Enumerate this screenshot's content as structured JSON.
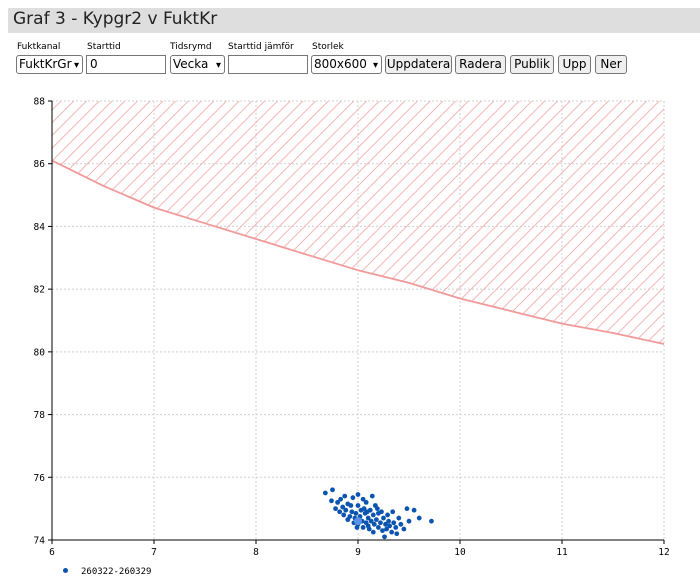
{
  "window": {
    "title": "Graf 3 - Kypgr2 v FuktKr"
  },
  "controls": {
    "fuktkanal": {
      "label": "Fuktkanal",
      "value": "FuktKrGr"
    },
    "starttid": {
      "label": "Starttid",
      "value": "0"
    },
    "tidsrymd": {
      "label": "Tidsrymd",
      "value": "Vecka"
    },
    "starttid_jamfor": {
      "label": "Starttid jämför",
      "value": ""
    },
    "storlek": {
      "label": "Storlek",
      "value": "800x600"
    },
    "buttons": {
      "uppdatera": "Uppdatera",
      "radera": "Radera",
      "publik": "Publik",
      "upp": "Upp",
      "ner": "Ner"
    }
  },
  "colors": {
    "limit_line": "#f09a9a",
    "hatch": "#f5b5b5",
    "points": "#0b55b0",
    "centroid": "#5b8fe8",
    "grid": "#d0d0d0"
  },
  "chart_data": {
    "type": "scatter",
    "xlim": [
      6,
      12
    ],
    "ylim": [
      74,
      88
    ],
    "x_ticks": [
      "6",
      "7",
      "8",
      "9",
      "10",
      "11",
      "12"
    ],
    "y_ticks": [
      "74",
      "76",
      "78",
      "80",
      "82",
      "84",
      "86",
      "88"
    ],
    "grid": true,
    "legend": {
      "placement": "bottom-left",
      "entries": [
        "260322-260329"
      ]
    },
    "limit_curve": {
      "x": [
        6,
        6.5,
        7,
        7.5,
        8,
        8.5,
        9,
        9.5,
        10,
        10.5,
        11,
        11.5,
        12
      ],
      "y": [
        86.1,
        85.3,
        84.6,
        84.1,
        83.6,
        83.1,
        82.6,
        82.2,
        81.7,
        81.3,
        80.9,
        80.6,
        80.25
      ]
    },
    "series": [
      {
        "name": "260322-260329",
        "centroid": [
          9.0,
          74.6
        ],
        "points": [
          [
            8.68,
            75.5
          ],
          [
            8.75,
            75.6
          ],
          [
            8.74,
            75.25
          ],
          [
            8.8,
            75.2
          ],
          [
            8.78,
            75.0
          ],
          [
            8.82,
            74.9
          ],
          [
            8.85,
            75.05
          ],
          [
            8.86,
            74.8
          ],
          [
            8.88,
            74.95
          ],
          [
            8.9,
            74.65
          ],
          [
            8.9,
            75.15
          ],
          [
            8.92,
            74.75
          ],
          [
            8.94,
            74.9
          ],
          [
            8.95,
            75.35
          ],
          [
            8.96,
            74.55
          ],
          [
            8.97,
            74.7
          ],
          [
            8.98,
            74.85
          ],
          [
            9.0,
            75.45
          ],
          [
            9.0,
            75.1
          ],
          [
            9.0,
            74.5
          ],
          [
            9.02,
            74.75
          ],
          [
            9.03,
            74.95
          ],
          [
            9.04,
            74.6
          ],
          [
            9.05,
            75.3
          ],
          [
            9.05,
            74.4
          ],
          [
            9.07,
            74.85
          ],
          [
            9.08,
            74.55
          ],
          [
            9.08,
            75.2
          ],
          [
            9.1,
            74.7
          ],
          [
            9.1,
            74.45
          ],
          [
            9.12,
            74.95
          ],
          [
            9.13,
            74.6
          ],
          [
            9.14,
            75.4
          ],
          [
            9.15,
            74.8
          ],
          [
            9.16,
            74.5
          ],
          [
            9.17,
            75.1
          ],
          [
            9.18,
            74.65
          ],
          [
            9.2,
            74.4
          ],
          [
            9.2,
            74.85
          ],
          [
            9.22,
            74.55
          ],
          [
            9.24,
            74.3
          ],
          [
            9.25,
            74.7
          ],
          [
            9.26,
            74.1
          ],
          [
            9.27,
            74.5
          ],
          [
            9.28,
            74.35
          ],
          [
            9.3,
            74.6
          ],
          [
            9.31,
            74.45
          ],
          [
            9.33,
            74.25
          ],
          [
            9.35,
            74.55
          ],
          [
            9.37,
            74.4
          ],
          [
            9.4,
            74.7
          ],
          [
            9.42,
            74.5
          ],
          [
            9.45,
            74.35
          ],
          [
            9.48,
            75.0
          ],
          [
            9.5,
            74.6
          ],
          [
            9.55,
            74.95
          ],
          [
            9.6,
            74.7
          ],
          [
            9.72,
            74.6
          ],
          [
            8.83,
            75.3
          ],
          [
            8.87,
            75.4
          ],
          [
            8.93,
            75.1
          ],
          [
            9.06,
            75.0
          ],
          [
            9.11,
            74.35
          ],
          [
            9.19,
            75.0
          ],
          [
            9.23,
            74.9
          ],
          [
            9.29,
            74.8
          ],
          [
            8.99,
            74.4
          ],
          [
            9.01,
            74.65
          ],
          [
            9.09,
            74.9
          ],
          [
            9.15,
            74.25
          ],
          [
            9.34,
            74.9
          ],
          [
            9.38,
            74.2
          ]
        ]
      }
    ]
  }
}
